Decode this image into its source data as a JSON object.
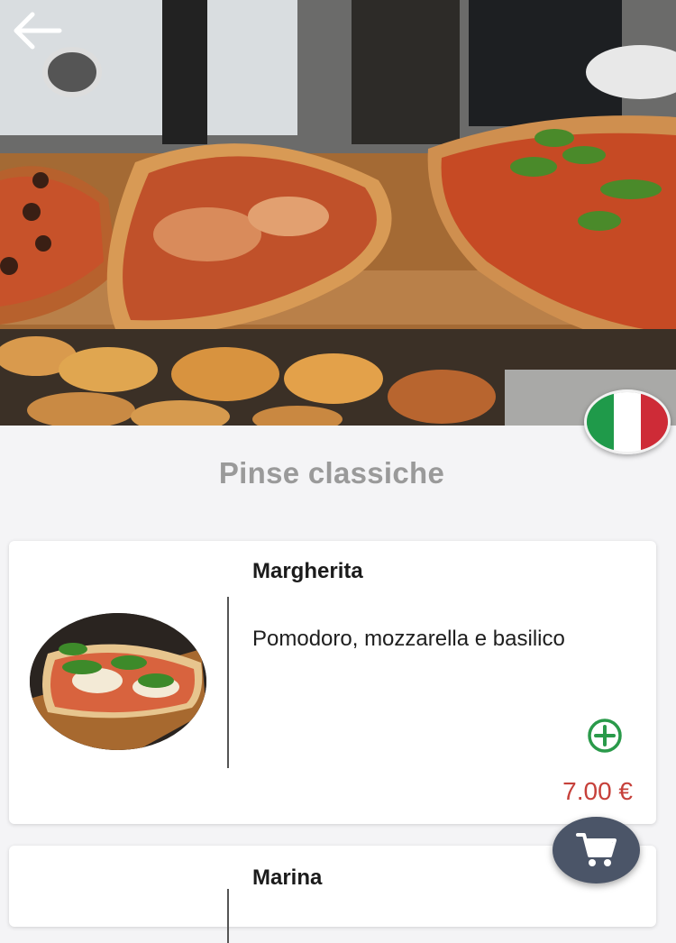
{
  "header": {
    "back_icon": "arrow-left-icon",
    "language_flag": {
      "icon": "italy-flag-icon",
      "colors": [
        "#1f9a4a",
        "#ffffff",
        "#ce2b37"
      ]
    }
  },
  "section": {
    "title": "Pinse classiche"
  },
  "products": [
    {
      "name": "Margherita",
      "description": "Pomodoro, mozzarella e basilico",
      "price": "7.00 €",
      "add_icon": "plus-circle-icon"
    },
    {
      "name": "Marina"
    }
  ],
  "cart": {
    "icon": "shopping-cart-icon"
  },
  "colors": {
    "accent_green": "#2a9a4a",
    "price_red": "#c6403a",
    "fab": "#4b5568",
    "title_gray": "#9a9a9a"
  }
}
